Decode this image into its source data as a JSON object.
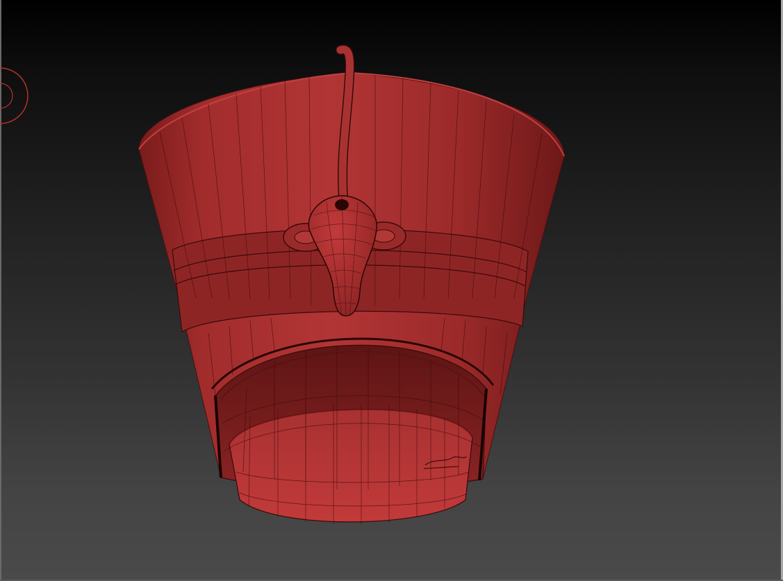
{
  "viewport": {
    "background_top": "#000000",
    "background_bottom": "#4a4a4a"
  },
  "model": {
    "name": "pharaoh-crown-mesh",
    "material_color": "#9a2a2a",
    "wire_color": "#3a0a0a",
    "wireframe_visible": true
  },
  "gizmo": {
    "icon": "rotate-gizmo-ring",
    "color": "#c0392b"
  }
}
